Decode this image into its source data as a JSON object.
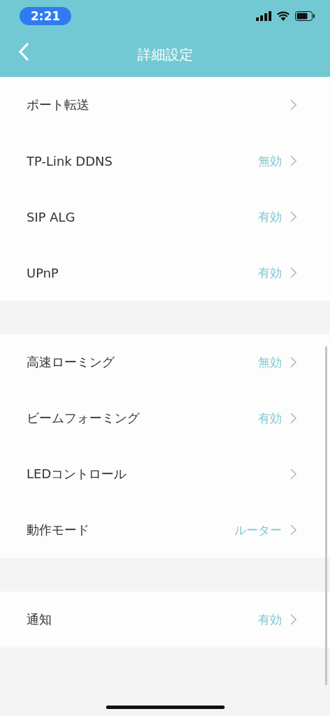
{
  "status_bar": {
    "time": "2:21"
  },
  "header": {
    "title": "詳細設定"
  },
  "groups": [
    {
      "rows": [
        {
          "label": "ポート転送"
        },
        {
          "label": "TP-Link DDNS",
          "value": "無効"
        },
        {
          "label": "SIP ALG",
          "value": "有効"
        },
        {
          "label": "UPnP",
          "value": "有効"
        }
      ]
    },
    {
      "rows": [
        {
          "label": "高速ローミング",
          "value": "無効"
        },
        {
          "label": "ビームフォーミング",
          "value": "有効"
        },
        {
          "label": "LEDコントロール"
        },
        {
          "label": "動作モード",
          "value": "ルーター"
        }
      ]
    },
    {
      "rows": [
        {
          "label": "通知",
          "value": "有効"
        }
      ]
    }
  ]
}
